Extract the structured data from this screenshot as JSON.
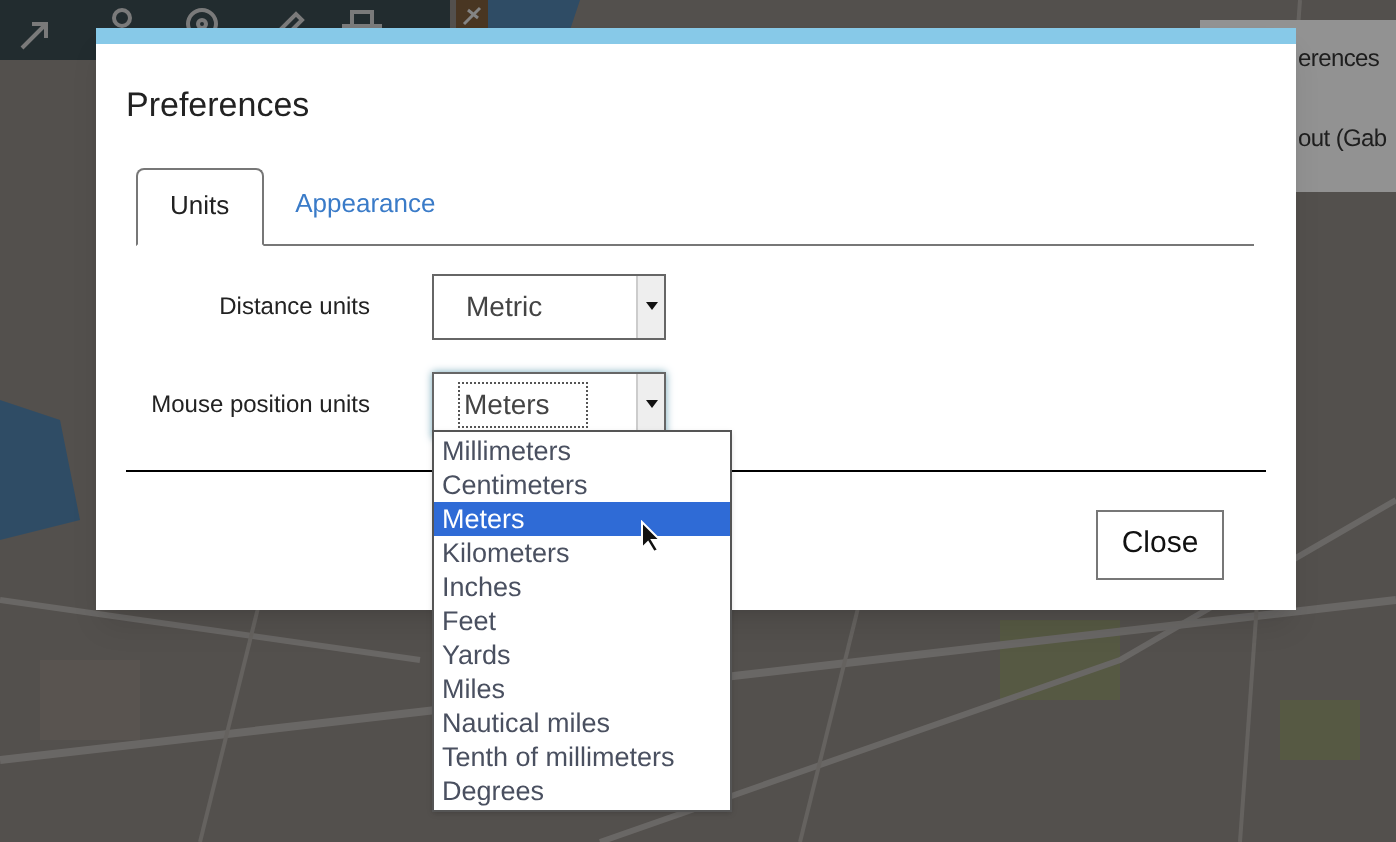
{
  "background_panel": {
    "items": [
      "erences",
      "out (Gab"
    ]
  },
  "dialog": {
    "title": "Preferences",
    "tabs": [
      {
        "label": "Units",
        "selected": true
      },
      {
        "label": "Appearance",
        "selected": false
      }
    ],
    "fields": [
      {
        "label": "Distance units",
        "value": "Metric",
        "focused": false
      },
      {
        "label": "Mouse position units",
        "value": "Meters",
        "focused": true
      }
    ],
    "dropdown": {
      "options": [
        {
          "label": "Millimeters",
          "selected": false
        },
        {
          "label": "Centimeters",
          "selected": false
        },
        {
          "label": "Meters",
          "selected": true
        },
        {
          "label": "Kilometers",
          "selected": false
        },
        {
          "label": "Inches",
          "selected": false
        },
        {
          "label": "Feet",
          "selected": false
        },
        {
          "label": "Yards",
          "selected": false
        },
        {
          "label": "Miles",
          "selected": false
        },
        {
          "label": "Nautical miles",
          "selected": false
        },
        {
          "label": "Tenth of millimeters",
          "selected": false
        },
        {
          "label": "Degrees",
          "selected": false
        }
      ]
    },
    "buttons": [
      "Close"
    ]
  }
}
